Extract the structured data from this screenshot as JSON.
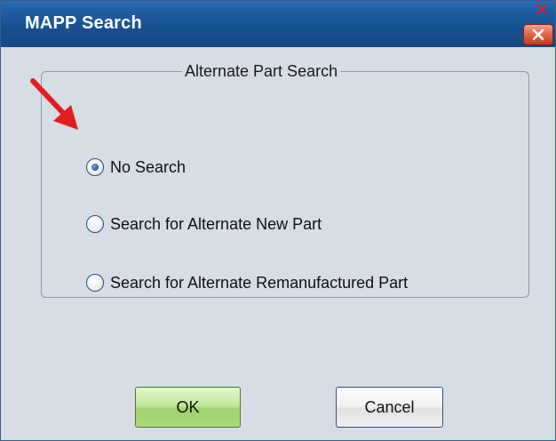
{
  "window": {
    "title": "MAPP Search"
  },
  "group": {
    "legend": "Alternate Part Search",
    "options": [
      {
        "label": "No Search",
        "checked": true
      },
      {
        "label": "Search for Alternate New Part",
        "checked": false
      },
      {
        "label": "Search for Alternate Remanufactured Part",
        "checked": false
      }
    ]
  },
  "buttons": {
    "ok": "OK",
    "cancel": "Cancel"
  },
  "colors": {
    "titlebar": "#1f5fa5",
    "close_button": "#d9553a",
    "ok_button": "#b4e08a",
    "annotation_arrow": "#e31c1c"
  },
  "icons": {
    "close": "close-x-icon",
    "annotation": "red-arrow-icon"
  }
}
